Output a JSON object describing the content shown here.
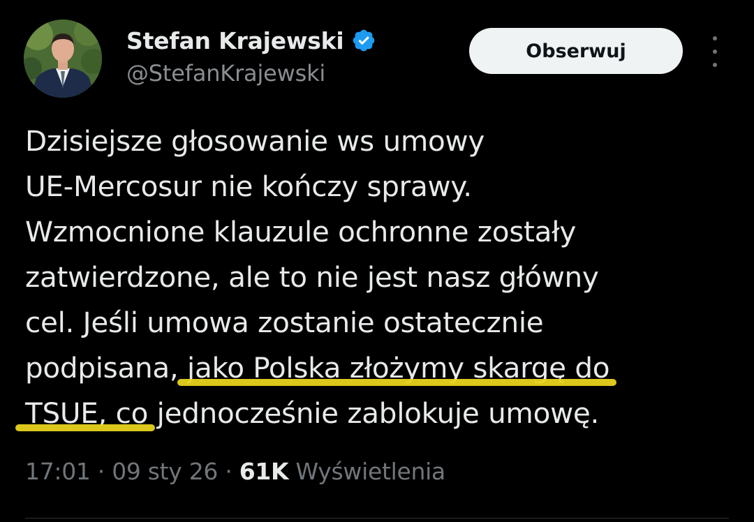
{
  "author": {
    "display_name": "Stefan Krajewski",
    "handle": "@StefanKrajewski"
  },
  "actions": {
    "follow_label": "Obserwuj"
  },
  "tweet": {
    "line1": "Dzisiejsze głosowanie ws umowy",
    "line2": "UE-Mercosur nie kończy sprawy.",
    "line3": "Wzmocnione klauzule ochronne zostały",
    "line4": "zatwierdzone, ale to nie jest nasz główny",
    "line5": "cel. Jeśli umowa zostanie ostatecznie",
    "line6_plain": "podpisana, ",
    "line6_highlight": "jako Polska złożymy skargę do",
    "line7_highlight": "TSUE, co",
    "line7_plain": " jednocześnie zablokuje umowę."
  },
  "meta": {
    "time": "17:01",
    "separator": " · ",
    "date": "09 sty 26",
    "views_count": "61K",
    "views_label": "Wyświetlenia"
  },
  "colors": {
    "background": "#000000",
    "text": "#e7e9ea",
    "secondary": "#71767b",
    "verified": "#1d9bf0",
    "highlight": "#e8d21d",
    "button_bg": "#eff3f4"
  },
  "icons": {
    "verified": "verified-badge-icon",
    "more": "more-vertical-icon"
  }
}
